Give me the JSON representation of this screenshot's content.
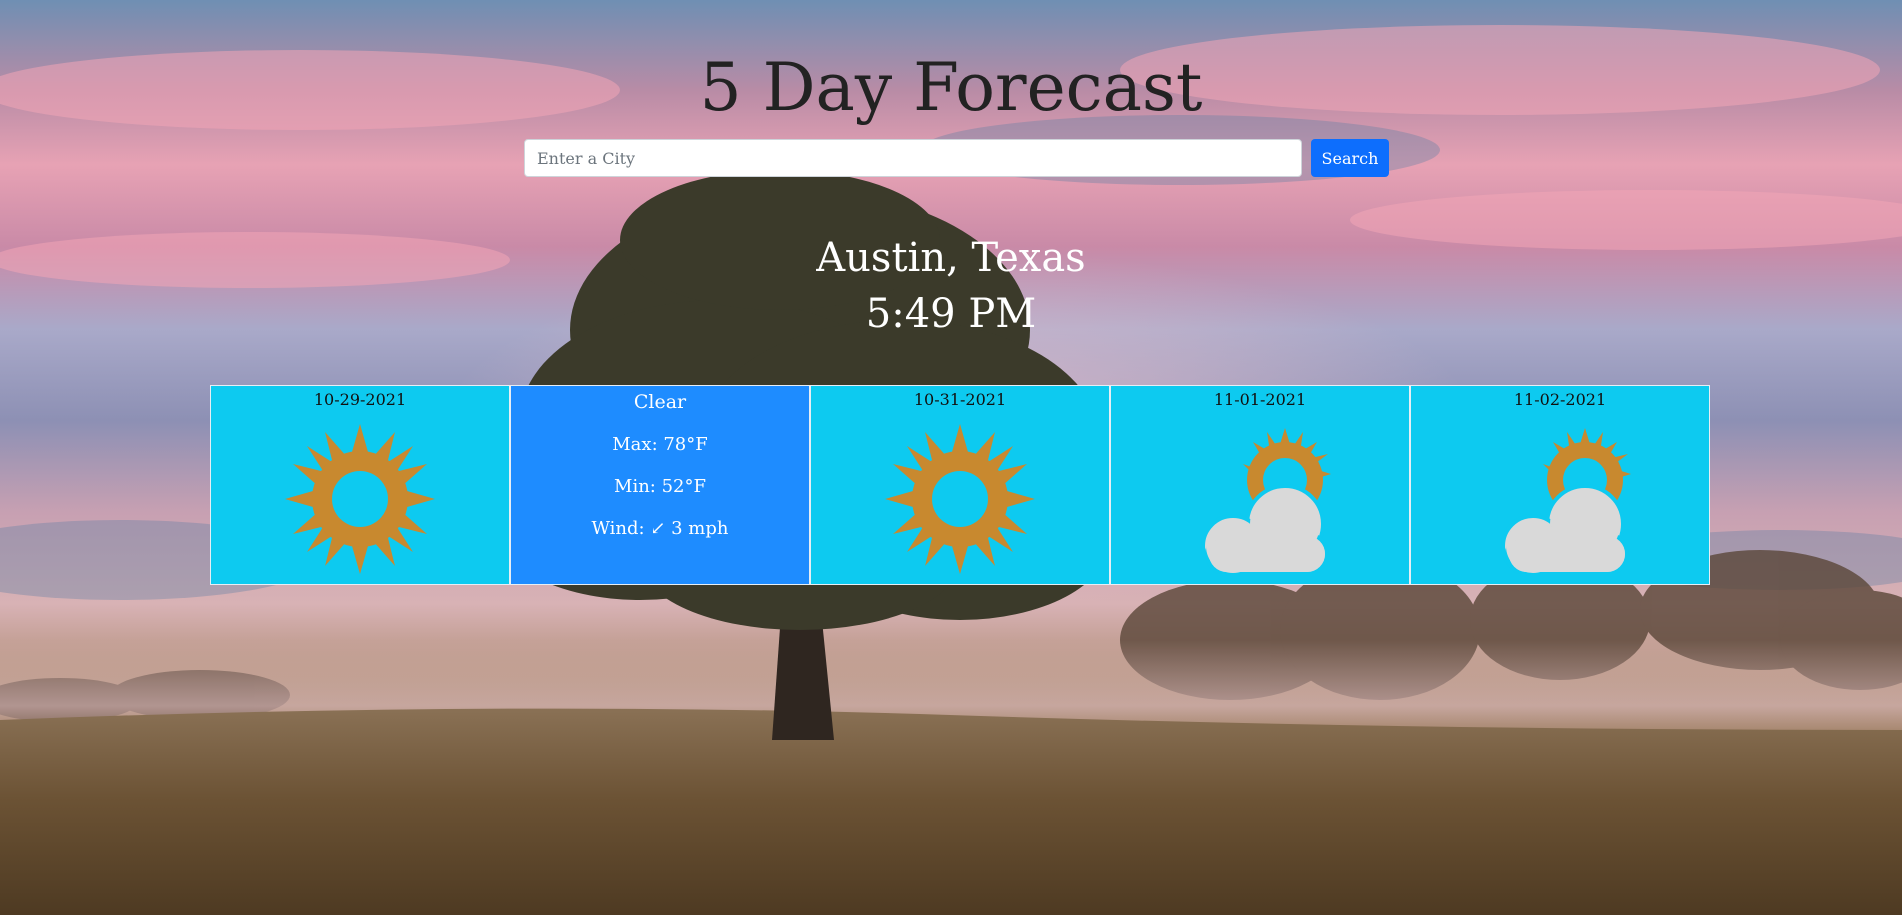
{
  "header": {
    "title": "5 Day Forecast"
  },
  "search": {
    "placeholder": "Enter a City",
    "value": "",
    "button_label": "Search"
  },
  "location": {
    "city": "Austin, Texas",
    "time": "5:49 PM"
  },
  "colors": {
    "card_background": "#0dcaf0",
    "active_card_background": "#1e8cff",
    "search_button": "#0d6efd",
    "sun": "#c8892f",
    "cloud": "#d9d9d9"
  },
  "forecast": [
    {
      "date": "10-29-2021",
      "icon": "sun-icon"
    },
    {
      "condition": "Clear",
      "max": "Max: 78°F",
      "min": "Min: 52°F",
      "wind": "Wind: ↙ 3 mph"
    },
    {
      "date": "10-31-2021",
      "icon": "sun-icon"
    },
    {
      "date": "11-01-2021",
      "icon": "partly-cloudy-icon"
    },
    {
      "date": "11-02-2021",
      "icon": "partly-cloudy-icon"
    }
  ]
}
